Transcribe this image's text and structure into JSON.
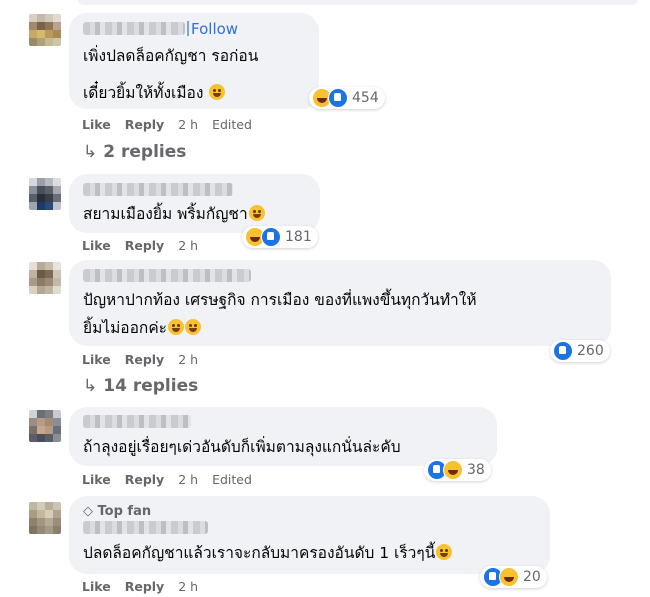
{
  "actions": {
    "like": "Like",
    "reply": "Reply",
    "edited": "Edited"
  },
  "comments": [
    {
      "follow_label": "Follow",
      "lines": [
        "เพิ่งปลดล็อคกัญชา รอก่อน",
        "เดี๋ยวยิ้มให้ทั้งเมือง"
      ],
      "time": "2 h",
      "edited": true,
      "reaction_count": "454",
      "replies": "2 replies"
    },
    {
      "lines": [
        "สยามเมืองยิ้ม พริ้มกัญชา"
      ],
      "time": "2 h",
      "reaction_count": "181"
    },
    {
      "lines": [
        "ปัญหาปากท้อง เศรษฐกิจ การเมือง ของที่แพงขึ้นทุกวันทำให้",
        "ยิ้มไม่ออกค่ะ"
      ],
      "time": "2 h",
      "reaction_count": "260",
      "replies": "14 replies"
    },
    {
      "lines": [
        "ถ้าลุงอยู่เรื่อยๆเด่วอันดับก็เพิ่มตามลุงแกนั่นล่ะคับ"
      ],
      "time": "2 h",
      "edited": true,
      "reaction_count": "38"
    },
    {
      "badge": "Top fan",
      "lines": [
        "ปลดล็อคกัญชาแล้วเราจะกลับมาครองอันดับ 1 เร็วๆนี้"
      ],
      "time": "2 h",
      "reaction_count": "20"
    }
  ],
  "icons": {
    "reply_arrow": "↳",
    "top_fan": "◇"
  },
  "colors": {
    "bubble": "#f0f2f5",
    "link_blue": "#2e6fd8",
    "meta_gray": "#65676b",
    "like_blue": "#1b74e4",
    "haha_yellow": "#f7c131"
  }
}
